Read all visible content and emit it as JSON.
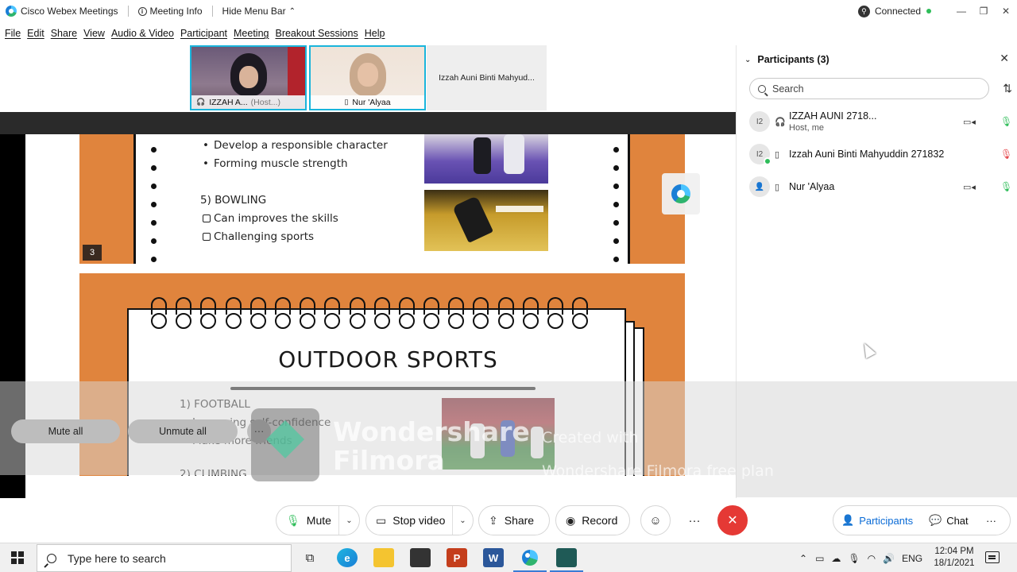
{
  "titlebar": {
    "app_name": "Cisco Webex Meetings",
    "meeting_info": "Meeting Info",
    "hide_menu_bar": "Hide Menu Bar",
    "connection_status": "Connected",
    "minimize": "—",
    "maximize": "❐",
    "close": "✕"
  },
  "menubar": {
    "items": [
      "File",
      "Edit",
      "Share",
      "View",
      "Audio & Video",
      "Participant",
      "Meeting",
      "Breakout Sessions",
      "Help"
    ]
  },
  "video_strip": {
    "thumbs": [
      {
        "name": "IZZAH A...",
        "role": "(Host...)"
      },
      {
        "name": "Nur 'Alyaa",
        "role": ""
      }
    ],
    "third_name": "Izzah Auni Binti Mahyud..."
  },
  "slide_top": {
    "bullets": [
      "Develop a responsible character",
      "Forming muscle strength"
    ],
    "heading": "5) BOWLING",
    "checks": [
      "Can improves the skills",
      "Challenging sports"
    ],
    "page_number": "3"
  },
  "slide_bottom": {
    "title": "OUTDOOR SPORTS",
    "heading": "1)  FOOTBALL",
    "items": [
      "Improving self-confidence",
      "Make more friends"
    ],
    "cut_heading": "2) CLIMBING"
  },
  "watermark": {
    "brand_line1": "Wondershare",
    "brand_line2": "Filmora",
    "created_line1": "Created with",
    "created_line2": "Wondershare Filmora free plan"
  },
  "participants_panel": {
    "title": "Participants (3)",
    "search_placeholder": "Search",
    "participants": [
      {
        "initials": "I2",
        "name": "IZZAH AUNI 2718...",
        "subtitle": "Host, me",
        "mic": "on"
      },
      {
        "initials": "I2",
        "name": "Izzah Auni Binti Mahyuddin 271832",
        "subtitle": "",
        "mic": "muted"
      },
      {
        "initials": "",
        "name": "Nur 'Alyaa",
        "subtitle": "",
        "mic": "on"
      }
    ],
    "mute_all": "Mute all",
    "unmute_all": "Unmute all",
    "more": "···"
  },
  "controls": {
    "mute": "Mute",
    "stop_video": "Stop video",
    "share": "Share",
    "record": "Record",
    "more": "···",
    "end": "✕",
    "participants_tab": "Participants",
    "chat_tab": "Chat",
    "more_tabs": "···"
  },
  "taskbar": {
    "search_placeholder": "Type here to search",
    "language": "ENG",
    "time": "12:04 PM",
    "date": "18/1/2021"
  },
  "colors": {
    "accent": "#1ab5dc",
    "slide_orange": "#e0843d",
    "end_call": "#e53935",
    "active_tab": "#0a6bd6",
    "connected": "#2ebd59"
  }
}
